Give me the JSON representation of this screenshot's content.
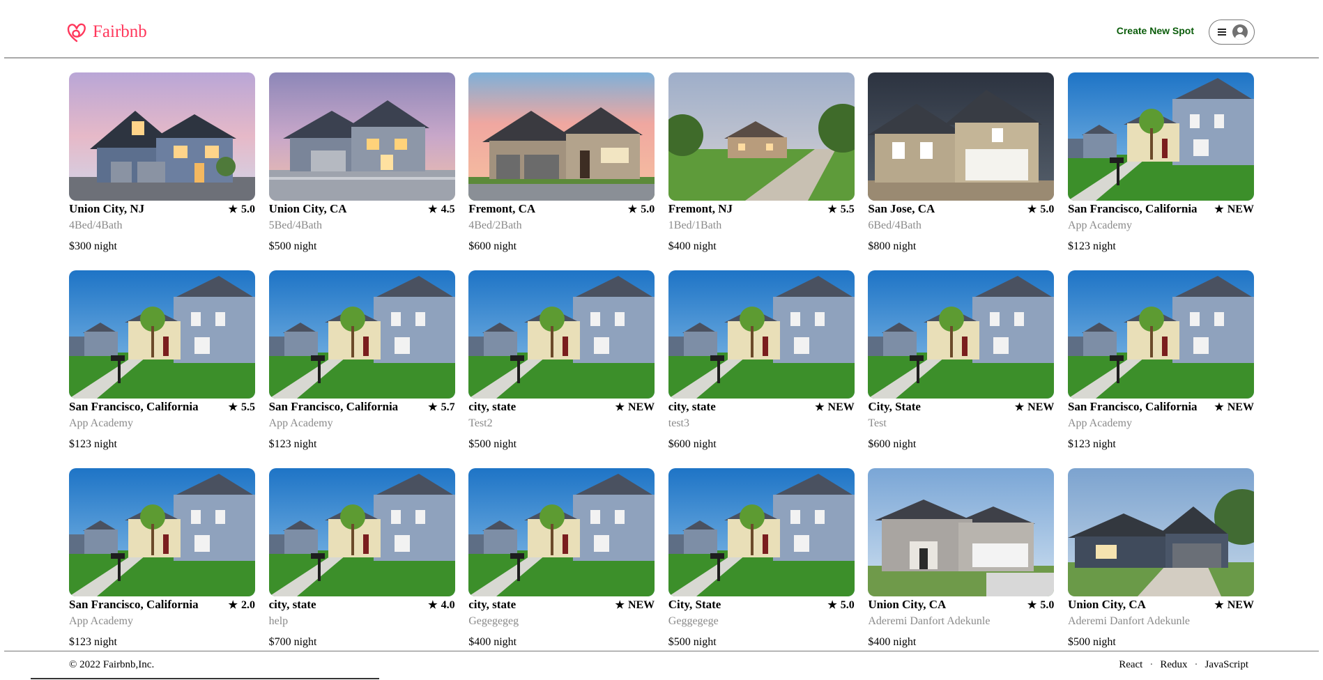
{
  "header": {
    "logo_text": "Fairbnb",
    "logo_icon": "airbnb-heart-icon",
    "create_spot_label": "Create New Spot",
    "menu_icon": "hamburger-menu-icon",
    "profile_icon": "user-avatar-icon"
  },
  "colors": {
    "brand": "#ff385c",
    "create_link": "#0a5c0a",
    "subtext": "#8a8a8a"
  },
  "spots": [
    {
      "city": "Union City, NJ",
      "rating": "5.0",
      "desc": "4Bed/4Bath",
      "price": "$300 night",
      "photo": "dusk-house"
    },
    {
      "city": "Union City, CA",
      "rating": "4.5",
      "desc": "5Bed/4Bath",
      "price": "$500 night",
      "photo": "wet-street-house"
    },
    {
      "city": "Fremont, CA",
      "rating": "5.0",
      "desc": "4Bed/2Bath",
      "price": "$600 night",
      "photo": "pink-sky-house"
    },
    {
      "city": "Fremont, NJ",
      "rating": "5.5",
      "desc": "1Bed/1Bath",
      "price": "$400 night",
      "photo": "country-house"
    },
    {
      "city": "San Jose, CA",
      "rating": "5.0",
      "desc": "6Bed/4Bath",
      "price": "$800 night",
      "photo": "tan-garage-house"
    },
    {
      "city": "San Francisco, California",
      "rating": "NEW",
      "desc": "App Academy",
      "price": "$123 night",
      "photo": "suburban-street"
    },
    {
      "city": "San Francisco, California",
      "rating": "5.5",
      "desc": "App Academy",
      "price": "$123 night",
      "photo": "suburban-street"
    },
    {
      "city": "San Francisco, California",
      "rating": "5.7",
      "desc": "App Academy",
      "price": "$123 night",
      "photo": "suburban-street"
    },
    {
      "city": "city, state",
      "rating": "NEW",
      "desc": "Test2",
      "price": "$500 night",
      "photo": "suburban-street"
    },
    {
      "city": "city, state",
      "rating": "NEW",
      "desc": "test3",
      "price": "$600 night",
      "photo": "suburban-street"
    },
    {
      "city": "City, State",
      "rating": "NEW",
      "desc": "Test",
      "price": "$600 night",
      "photo": "suburban-street"
    },
    {
      "city": "San Francisco, California",
      "rating": "NEW",
      "desc": "App Academy",
      "price": "$123 night",
      "photo": "suburban-street"
    },
    {
      "city": "San Francisco, California",
      "rating": "2.0",
      "desc": "App Academy",
      "price": "$123 night",
      "photo": "suburban-street"
    },
    {
      "city": "city, state",
      "rating": "4.0",
      "desc": "help",
      "price": "$700 night",
      "photo": "suburban-street"
    },
    {
      "city": "city, state",
      "rating": "NEW",
      "desc": "Gegegegeg",
      "price": "$400 night",
      "photo": "suburban-street"
    },
    {
      "city": "City, State",
      "rating": "5.0",
      "desc": "Geggegege",
      "price": "$500 night",
      "photo": "suburban-street"
    },
    {
      "city": "Union City, CA",
      "rating": "5.0",
      "desc": "Aderemi Danfort Adekunle",
      "price": "$400 night",
      "photo": "colonial-house"
    },
    {
      "city": "Union City, CA",
      "rating": "NEW",
      "desc": "Aderemi Danfort Adekunle",
      "price": "$500 night",
      "photo": "blue-ranch-house"
    }
  ],
  "footer": {
    "copyright": "© 2022 Fairbnb,Inc.",
    "links": [
      "React",
      "Redux",
      "JavaScript"
    ],
    "separator": "·"
  }
}
